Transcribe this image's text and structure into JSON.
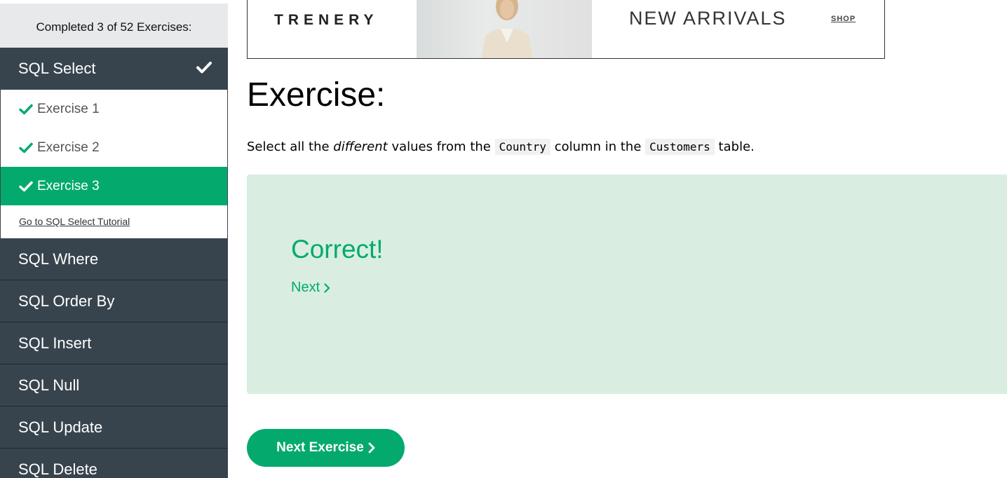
{
  "sidebar": {
    "progress": "Completed 3 of 52 Exercises:",
    "active_section": {
      "label": "SQL Select",
      "icon": "check-icon",
      "items": [
        {
          "label": "Exercise 1",
          "done": true
        },
        {
          "label": "Exercise 2",
          "done": true
        },
        {
          "label": "Exercise 3",
          "done": true,
          "current": true
        }
      ],
      "tutorial_link": "Go to SQL Select Tutorial"
    },
    "sections": [
      {
        "label": "SQL Where"
      },
      {
        "label": "SQL Order By"
      },
      {
        "label": "SQL Insert"
      },
      {
        "label": "SQL Null"
      },
      {
        "label": "SQL Update"
      },
      {
        "label": "SQL Delete"
      }
    ]
  },
  "ad": {
    "brand": "TRENERY",
    "headline": "NEW ARRIVALS",
    "cta": "SHOP"
  },
  "exercise": {
    "title": "Exercise:",
    "instruction_prefix": "Select all the ",
    "instruction_emphasis": "different",
    "instruction_middle1": " values from the ",
    "code_column": "Country",
    "instruction_middle2": " column in the ",
    "code_table": "Customers",
    "instruction_suffix": " table."
  },
  "result": {
    "title": "Correct!",
    "next_link": "Next"
  },
  "next_exercise_button": "Next Exercise",
  "colors": {
    "accent": "#04aa6d",
    "sidebar_dark": "#38444d",
    "result_bg": "#d9eee1"
  }
}
